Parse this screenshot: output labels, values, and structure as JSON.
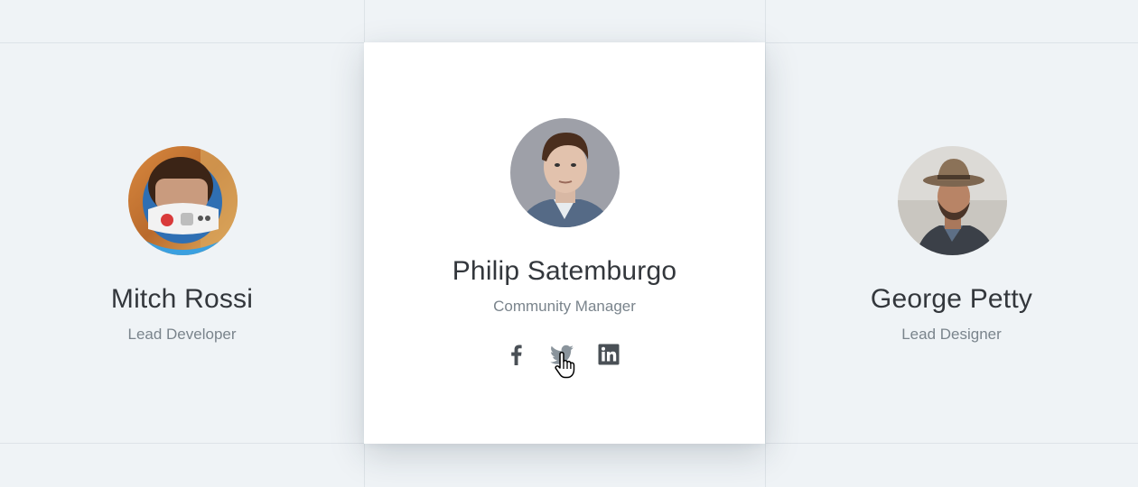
{
  "team": {
    "left": {
      "name": "Mitch Rossi",
      "role": "Lead Developer",
      "avatar_icon": "avatar-photo-astronaut-helmet"
    },
    "center": {
      "name": "Philip Satemburgo",
      "role": "Community Manager",
      "avatar_icon": "avatar-photo-man-suit",
      "socials": [
        {
          "icon": "facebook-icon"
        },
        {
          "icon": "twitter-icon"
        },
        {
          "icon": "linkedin-icon"
        }
      ]
    },
    "right": {
      "name": "George Petty",
      "role": "Lead Designer",
      "avatar_icon": "avatar-photo-man-hat"
    }
  },
  "colors": {
    "background": "#eff3f6",
    "card": "#ffffff",
    "name_text": "#33373c",
    "role_text": "#7a848c",
    "icon": "#4a5056",
    "twitter_hover": "#8a949c"
  },
  "cursor": "hand-pointer-icon"
}
